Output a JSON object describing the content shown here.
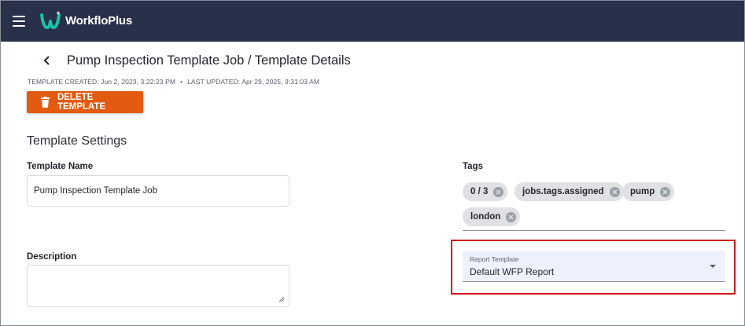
{
  "app": {
    "name": "WorkfloPlus",
    "brand_color": "#28304a",
    "logo_color": "#19c3a6"
  },
  "header": {
    "title": "Pump Inspection Template Job / Template Details",
    "meta_created": "TEMPLATE CREATED: Jun 2, 2023, 3:22:23 PM",
    "meta_separator": "•",
    "meta_updated": "LAST UPDATED: Apr 29, 2025, 9:31:03 AM"
  },
  "actions": {
    "delete_label": "DELETE TEMPLATE",
    "delete_color": "#e35b10"
  },
  "settings": {
    "section_title": "Template Settings",
    "template_name_label": "Template Name",
    "template_name_value": "Pump Inspection Template Job",
    "description_label": "Description",
    "description_value": "",
    "tags_label": "Tags",
    "tags": [
      "0 / 3",
      "jobs.tags.assigned",
      "pump",
      "london"
    ],
    "report_template_label": "Report Template",
    "report_template_value": "Default WFP Report",
    "highlight_color": "#d3171b"
  },
  "icons": {
    "menu": "hamburger-menu-icon",
    "back": "chevron-left-icon",
    "delete": "trash-icon",
    "chip_remove": "close-circle-icon",
    "dropdown": "caret-down-icon"
  }
}
